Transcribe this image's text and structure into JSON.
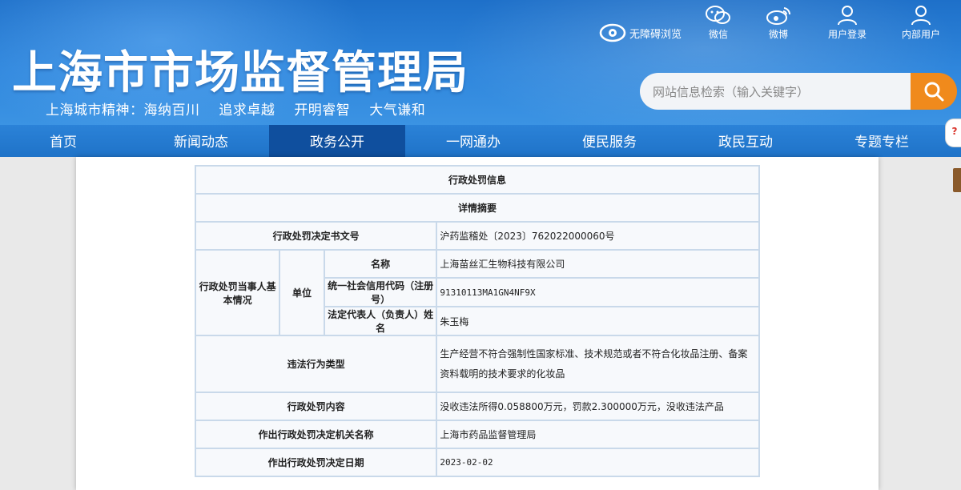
{
  "header": {
    "site_title": "上海市市场监督管理局",
    "slogan": [
      "上海城市精神：海纳百川",
      "追求卓越",
      "开明睿智",
      "大气谦和"
    ],
    "accessibility_label": "无障碍浏览",
    "top_links": [
      {
        "label": "微信",
        "icon": "wechat-icon"
      },
      {
        "label": "微博",
        "icon": "weibo-icon"
      },
      {
        "label": "用户登录",
        "icon": "user-icon"
      },
      {
        "label": "内部用户",
        "icon": "user-icon"
      }
    ],
    "search_placeholder": "网站信息检索（输入关键字）"
  },
  "nav": {
    "items": [
      "首页",
      "新闻动态",
      "政务公开",
      "一网通办",
      "便民服务",
      "政民互动",
      "专题专栏"
    ],
    "active_index": 2
  },
  "table": {
    "title": "行政处罚信息",
    "subtitle": "详情摘要",
    "doc_no_label": "行政处罚决定书文号",
    "doc_no_value": "沪药监稽处〔2023〕762022000060号",
    "party_label": "行政处罚当事人基本情况",
    "unit_label": "单位",
    "name_label": "名称",
    "name_value": "上海苗丝汇生物科技有限公司",
    "credit_label": "统一社会信用代码（注册号）",
    "credit_value": "91310113MA1GN4NF9X",
    "rep_label": "法定代表人（负责人）姓名",
    "rep_value": "朱玉梅",
    "violation_label": "违法行为类型",
    "violation_value": "生产经营不符合强制性国家标准、技术规范或者不符合化妆品注册、备案资料载明的技术要求的化妆品",
    "penalty_label": "行政处罚内容",
    "penalty_value": "没收违法所得0.058800万元，罚款2.300000万元，没收违法产品",
    "authority_label": "作出行政处罚决定机关名称",
    "authority_value": "上海市药品监督管理局",
    "date_label": "作出行政处罚决定日期",
    "date_value": "2023-02-02"
  },
  "colors": {
    "header_blue": "#2f86dc",
    "nav_active": "#0f4f9e",
    "search_button": "#f08a1c"
  }
}
